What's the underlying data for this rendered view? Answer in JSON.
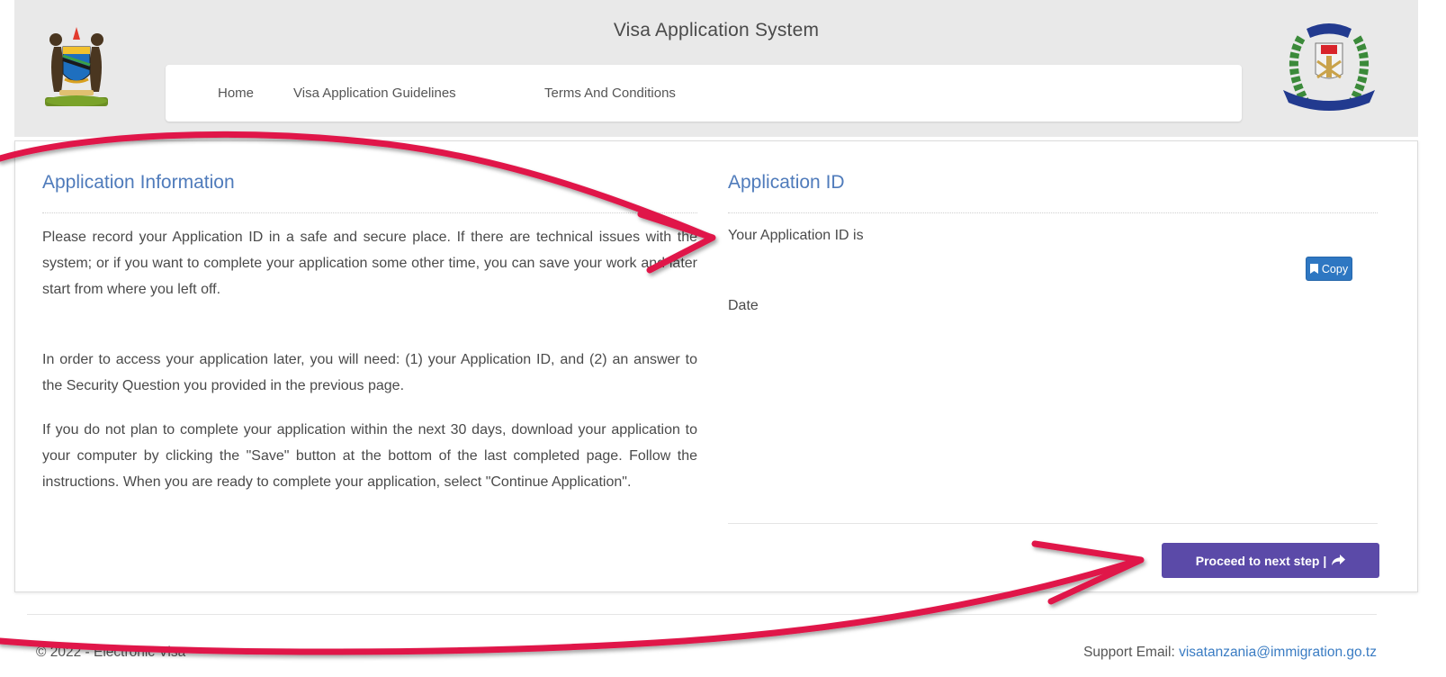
{
  "header": {
    "title": "Visa Application System",
    "nav": [
      {
        "label": "Home"
      },
      {
        "label": "Visa Application Guidelines"
      },
      {
        "label": "Terms And Conditions"
      }
    ]
  },
  "left_panel": {
    "title": "Application Information",
    "paragraphs": [
      "Please record your Application ID in a safe and secure place. If there are technical issues with the system; or if you want to complete your application some other time, you can save your work and later start from where you left off.",
      "In order to access your application later, you will need: (1) your Application ID, and (2) an answer to the Security Question you provided in the previous page.",
      "If you do not plan to complete your application within the next 30 days, download your application to your computer by clicking the \"Save\" button at the bottom of the last completed page. Follow the instructions. When you are ready to complete your application, select \"Continue Application\"."
    ]
  },
  "right_panel": {
    "title": "Application ID",
    "id_label": "Your Application ID is",
    "copy_label": "Copy",
    "date_label": "Date",
    "proceed_label": "Proceed to next step |"
  },
  "footer": {
    "left_text": "© 2022 - Electronic Visa",
    "support_label": "Support Email:",
    "support_email": "visatanzania@immigration.go.tz"
  },
  "colors": {
    "header_bg": "#e9e9e9",
    "section_title": "#4f7bbb",
    "copy_button": "#2e77c2",
    "proceed_button": "#5b4aa8",
    "annotation_arrow": "#e0194a",
    "email_link": "#3a7cc3"
  },
  "icons": {
    "copy": "bookmark-icon",
    "proceed": "share-arrow-icon"
  }
}
